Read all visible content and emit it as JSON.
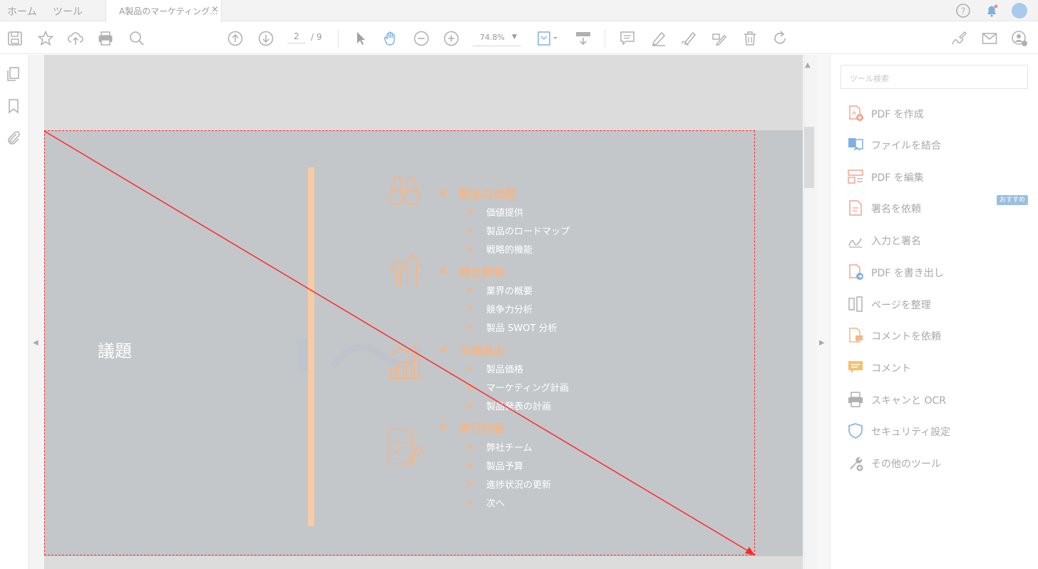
{
  "tabs": {
    "home": "ホーム",
    "tools": "ツール",
    "document_title": "A製品のマーケティング...",
    "close": "×"
  },
  "toolbar": {
    "current_page": "2",
    "total_pages": "/ 9",
    "zoom": "74.8%",
    "zoom_caret": "▼"
  },
  "slide": {
    "title": "議題",
    "sections": [
      {
        "heading": "製品の概要",
        "icon": "binoculars-icon",
        "items": [
          "価値提供",
          "製品のロードマップ",
          "戦略的機能"
        ]
      },
      {
        "heading": "競合関係",
        "icon": "arrows-up-icon",
        "items": [
          "業界の概要",
          "競争力分析",
          "製品 SWOT 分析"
        ]
      },
      {
        "heading": "市場進出",
        "icon": "bar-chart-icon",
        "items": [
          "製品価格",
          "マーケティング計画",
          "製品発表の計画"
        ]
      },
      {
        "heading": "実行計画",
        "icon": "checklist-icon",
        "items": [
          "弊社チーム",
          "製品予算",
          "進捗状況の更新",
          "次へ"
        ]
      }
    ]
  },
  "tools_panel": {
    "search_placeholder": "ツール検索",
    "recommend_badge": "おすすめ",
    "items": [
      {
        "label": "PDF を作成",
        "icon": "create-pdf-icon",
        "color": "#f0a58f"
      },
      {
        "label": "ファイルを結合",
        "icon": "combine-files-icon",
        "color": "#7fb0e0"
      },
      {
        "label": "PDF を編集",
        "icon": "edit-pdf-icon",
        "color": "#f0a58f"
      },
      {
        "label": "署名を依頼",
        "icon": "request-signature-icon",
        "color": "#f0a58f"
      },
      {
        "label": "入力と署名",
        "icon": "fill-sign-icon",
        "color": "#b0b0b0"
      },
      {
        "label": "PDF を書き出し",
        "icon": "export-pdf-icon",
        "color": "#7fb0e0"
      },
      {
        "label": "ページを整理",
        "icon": "organize-pages-icon",
        "color": "#b0b0b0"
      },
      {
        "label": "コメントを依頼",
        "icon": "request-comment-icon",
        "color": "#f3b789"
      },
      {
        "label": "コメント",
        "icon": "comment-icon",
        "color": "#f3c26f"
      },
      {
        "label": "スキャンと OCR",
        "icon": "scan-ocr-icon",
        "color": "#b0b0b0"
      },
      {
        "label": "セキュリティ設定",
        "icon": "security-shield-icon",
        "color": "#7fb0e0"
      },
      {
        "label": "その他のツール",
        "icon": "more-tools-icon",
        "color": "#b0b0b0"
      }
    ]
  },
  "colors": {
    "accent_orange": "#f3b789",
    "slide_bg": "#c3c7ca",
    "selection_red": "#ff2a2a"
  }
}
